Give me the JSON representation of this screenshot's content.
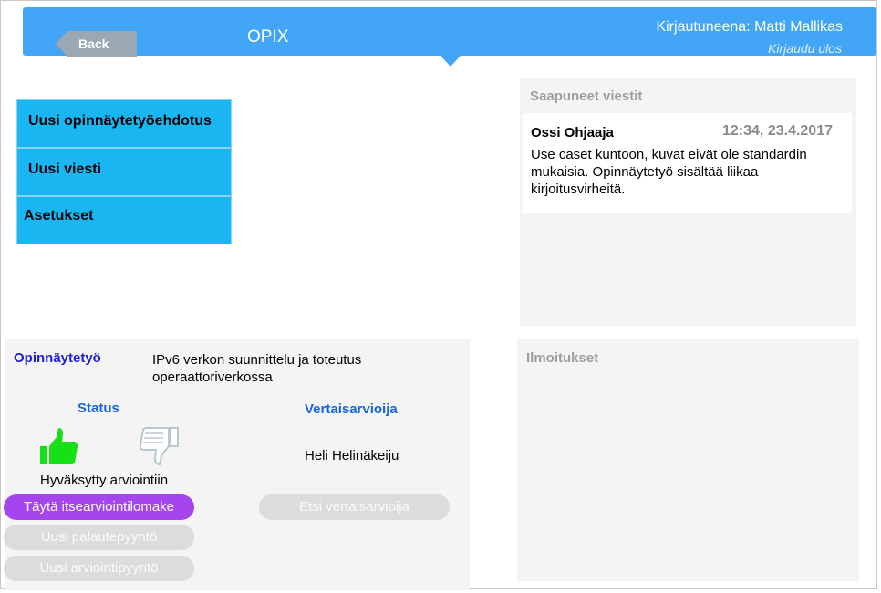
{
  "header": {
    "back_label": "Back",
    "app_title": "OPIX",
    "logged_in": "Kirjautuneena: Matti Mallikas",
    "logout": "Kirjaudu ulos",
    "color": "#42a5f5"
  },
  "menu": {
    "items": [
      {
        "label": "Uusi opinnäytetyöehdotus"
      },
      {
        "label": "Uusi viesti"
      },
      {
        "label": "Asetukset"
      }
    ],
    "color": "#1ab6f2"
  },
  "inbox": {
    "title": "Saapuneet viestit",
    "messages": [
      {
        "sender": "Ossi Ohjaaja",
        "time": "12:34, 23.4.2017",
        "body": "Use caset kuntoon, kuvat eivät ole standardin mukaisia. Opinnäytetyö sisältää liikaa kirjoitusvirheitä."
      }
    ]
  },
  "notices": {
    "title": "Ilmoitukset"
  },
  "thesis": {
    "label": "Opinnäytetyö",
    "title": "IPv6 verkon suunnittelu ja toteutus operaattoriverkossa",
    "status_heading": "Status",
    "status_text": "Hyväksytty arviointiin",
    "status_icons": {
      "approved": "thumbs-up-icon",
      "rejected": "thumbs-down-icon"
    },
    "peer_heading": "Vertaisarvioija",
    "peer_name": "Heli Helinäkeiju",
    "buttons": {
      "self_assessment": "Täytä itsearviointilomake",
      "find_peer": "Etsi vertaisarvioija",
      "feedback_request": "Uusi palautepyyntö",
      "assessment_request": "Uusi arviointipyyntö"
    },
    "accent_color": "#a545ed"
  }
}
